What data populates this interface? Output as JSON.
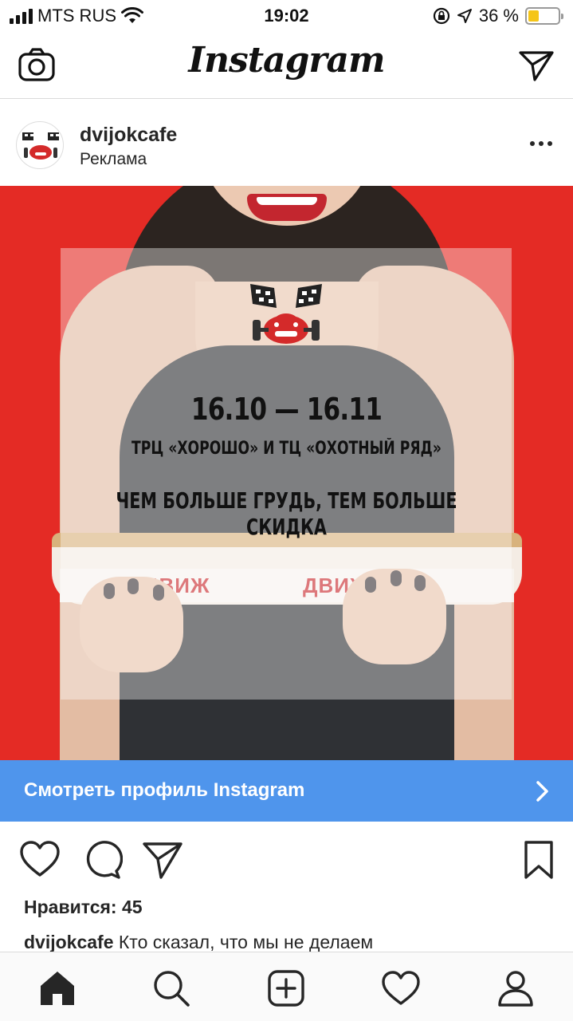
{
  "status_bar": {
    "carrier": "MTS RUS",
    "time": "19:02",
    "battery_percent": "36 %",
    "battery_level": 0.36,
    "icons": [
      "signal-icon",
      "wifi-icon",
      "rotation-lock-icon",
      "location-icon",
      "battery-icon"
    ]
  },
  "header": {
    "app_title": "Instagram",
    "left_icon": "camera-icon",
    "right_icon": "direct-message-icon"
  },
  "post": {
    "username": "dvijokcafe",
    "sponsored_label": "Реклама",
    "ad": {
      "dates": "16.10 — 16.11",
      "venue": "ТРЦ «ХОРОШО» И ТЦ «ОХОТНЫЙ РЯД»",
      "slogan": "ЧЕМ БОЛЬШЕ ГРУДЬ, ТЕМ БОЛЬШЕ СКИДКА",
      "tray_brand_1": "ДВИЖ",
      "tray_brand_2": "ДВИЖОК"
    },
    "cta_label": "Смотреть профиль Instagram",
    "likes_label": "Нравится: 45",
    "caption_user": "dvijokcafe",
    "caption_text": "Кто сказал, что мы не делаем"
  },
  "colors": {
    "ad_background": "#e42b25",
    "cta_background": "#4f95ec",
    "battery_fill": "#f5c518"
  },
  "tabbar": {
    "tabs": [
      "home-icon",
      "search-icon",
      "new-post-icon",
      "activity-icon",
      "profile-icon"
    ]
  }
}
